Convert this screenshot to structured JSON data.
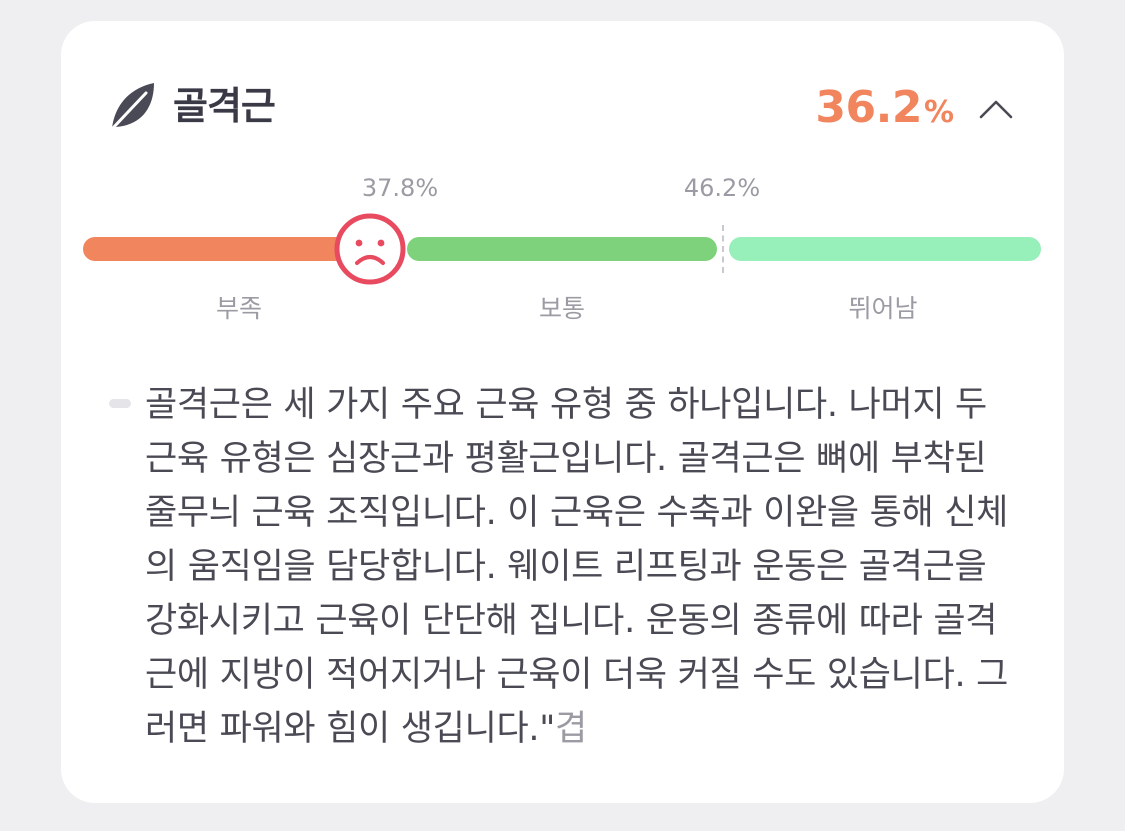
{
  "card": {
    "title": "골격근",
    "icon": "leaf-icon",
    "value": "36.2",
    "unit": "%",
    "value_percent": 36.2,
    "collapse_icon": "chevron-up-icon"
  },
  "scale": {
    "thresholds": [
      "37.8%",
      "46.2%"
    ],
    "segments": [
      {
        "label": "부족",
        "color": "#f0855e"
      },
      {
        "label": "보통",
        "color": "#7fd27c"
      },
      {
        "label": "뛰어남",
        "color": "#97efb9"
      }
    ],
    "marker_icon": "sad-face-icon",
    "marker_color": "#e84a5f"
  },
  "description": {
    "text": "골격근은 세 가지 주요 근육 유형 중 하나입니다. 나머지 두 근육 유형은 심장근과 평활근입니다. 골격근은 뼈에 부착된 줄무늬 근육 조직입니다. 이 근육은 수축과 이완을 통해 신체의 움직임을 담당합니다. 웨이트 리프팅과 운동은 골격근을 강화시키고 근육이 단단해 집니다. 운동의 종류에 따라 골격근에 지방이 적어지거나 근육이 더욱 커질 수도 있습니다. 그러면 파워와 힘이 생깁니다.\"",
    "link": "겹"
  }
}
